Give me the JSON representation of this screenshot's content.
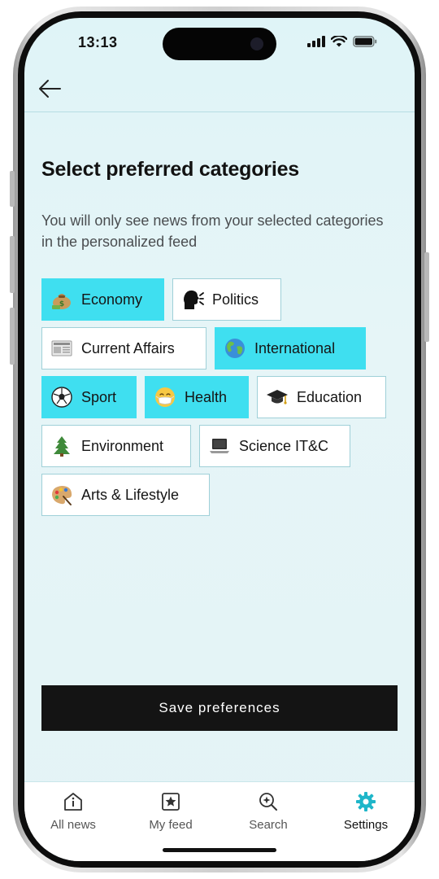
{
  "status_bar": {
    "time": "13:13",
    "icons": [
      "cellular-signal-icon",
      "wifi-icon",
      "battery-icon"
    ]
  },
  "header": {
    "back_icon": "arrow-left-icon"
  },
  "page": {
    "title": "Select preferred categories",
    "subtitle": "You will only see news from your selected categories in the personalized feed"
  },
  "categories": [
    {
      "label": "Economy",
      "icon": "money-bag-icon",
      "selected": true
    },
    {
      "label": "Politics",
      "icon": "speaking-head-icon",
      "selected": false
    },
    {
      "label": "Current Affairs",
      "icon": "newspaper-icon",
      "selected": false
    },
    {
      "label": "International",
      "icon": "globe-icon",
      "selected": true
    },
    {
      "label": "Sport",
      "icon": "soccer-ball-icon",
      "selected": true
    },
    {
      "label": "Health",
      "icon": "mask-face-icon",
      "selected": true
    },
    {
      "label": "Education",
      "icon": "graduation-cap-icon",
      "selected": false
    },
    {
      "label": "Environment",
      "icon": "evergreen-tree-icon",
      "selected": false
    },
    {
      "label": "Science IT&C",
      "icon": "laptop-icon",
      "selected": false
    },
    {
      "label": "Arts & Lifestyle",
      "icon": "artist-palette-icon",
      "selected": false
    }
  ],
  "actions": {
    "save_label": "Save preferences"
  },
  "tabbar": {
    "tabs": [
      {
        "label": "All news",
        "icon": "home-info-icon",
        "active": false
      },
      {
        "label": "My feed",
        "icon": "star-box-icon",
        "active": false
      },
      {
        "label": "Search",
        "icon": "search-sparkle-icon",
        "active": false
      },
      {
        "label": "Settings",
        "icon": "gear-icon",
        "active": true
      }
    ]
  },
  "colors": {
    "selected_chip": "#3fdff0",
    "chip_border": "#9fd0d8",
    "accent": "#1fb6c9",
    "background": "#e2f4f7",
    "button": "#141414"
  }
}
